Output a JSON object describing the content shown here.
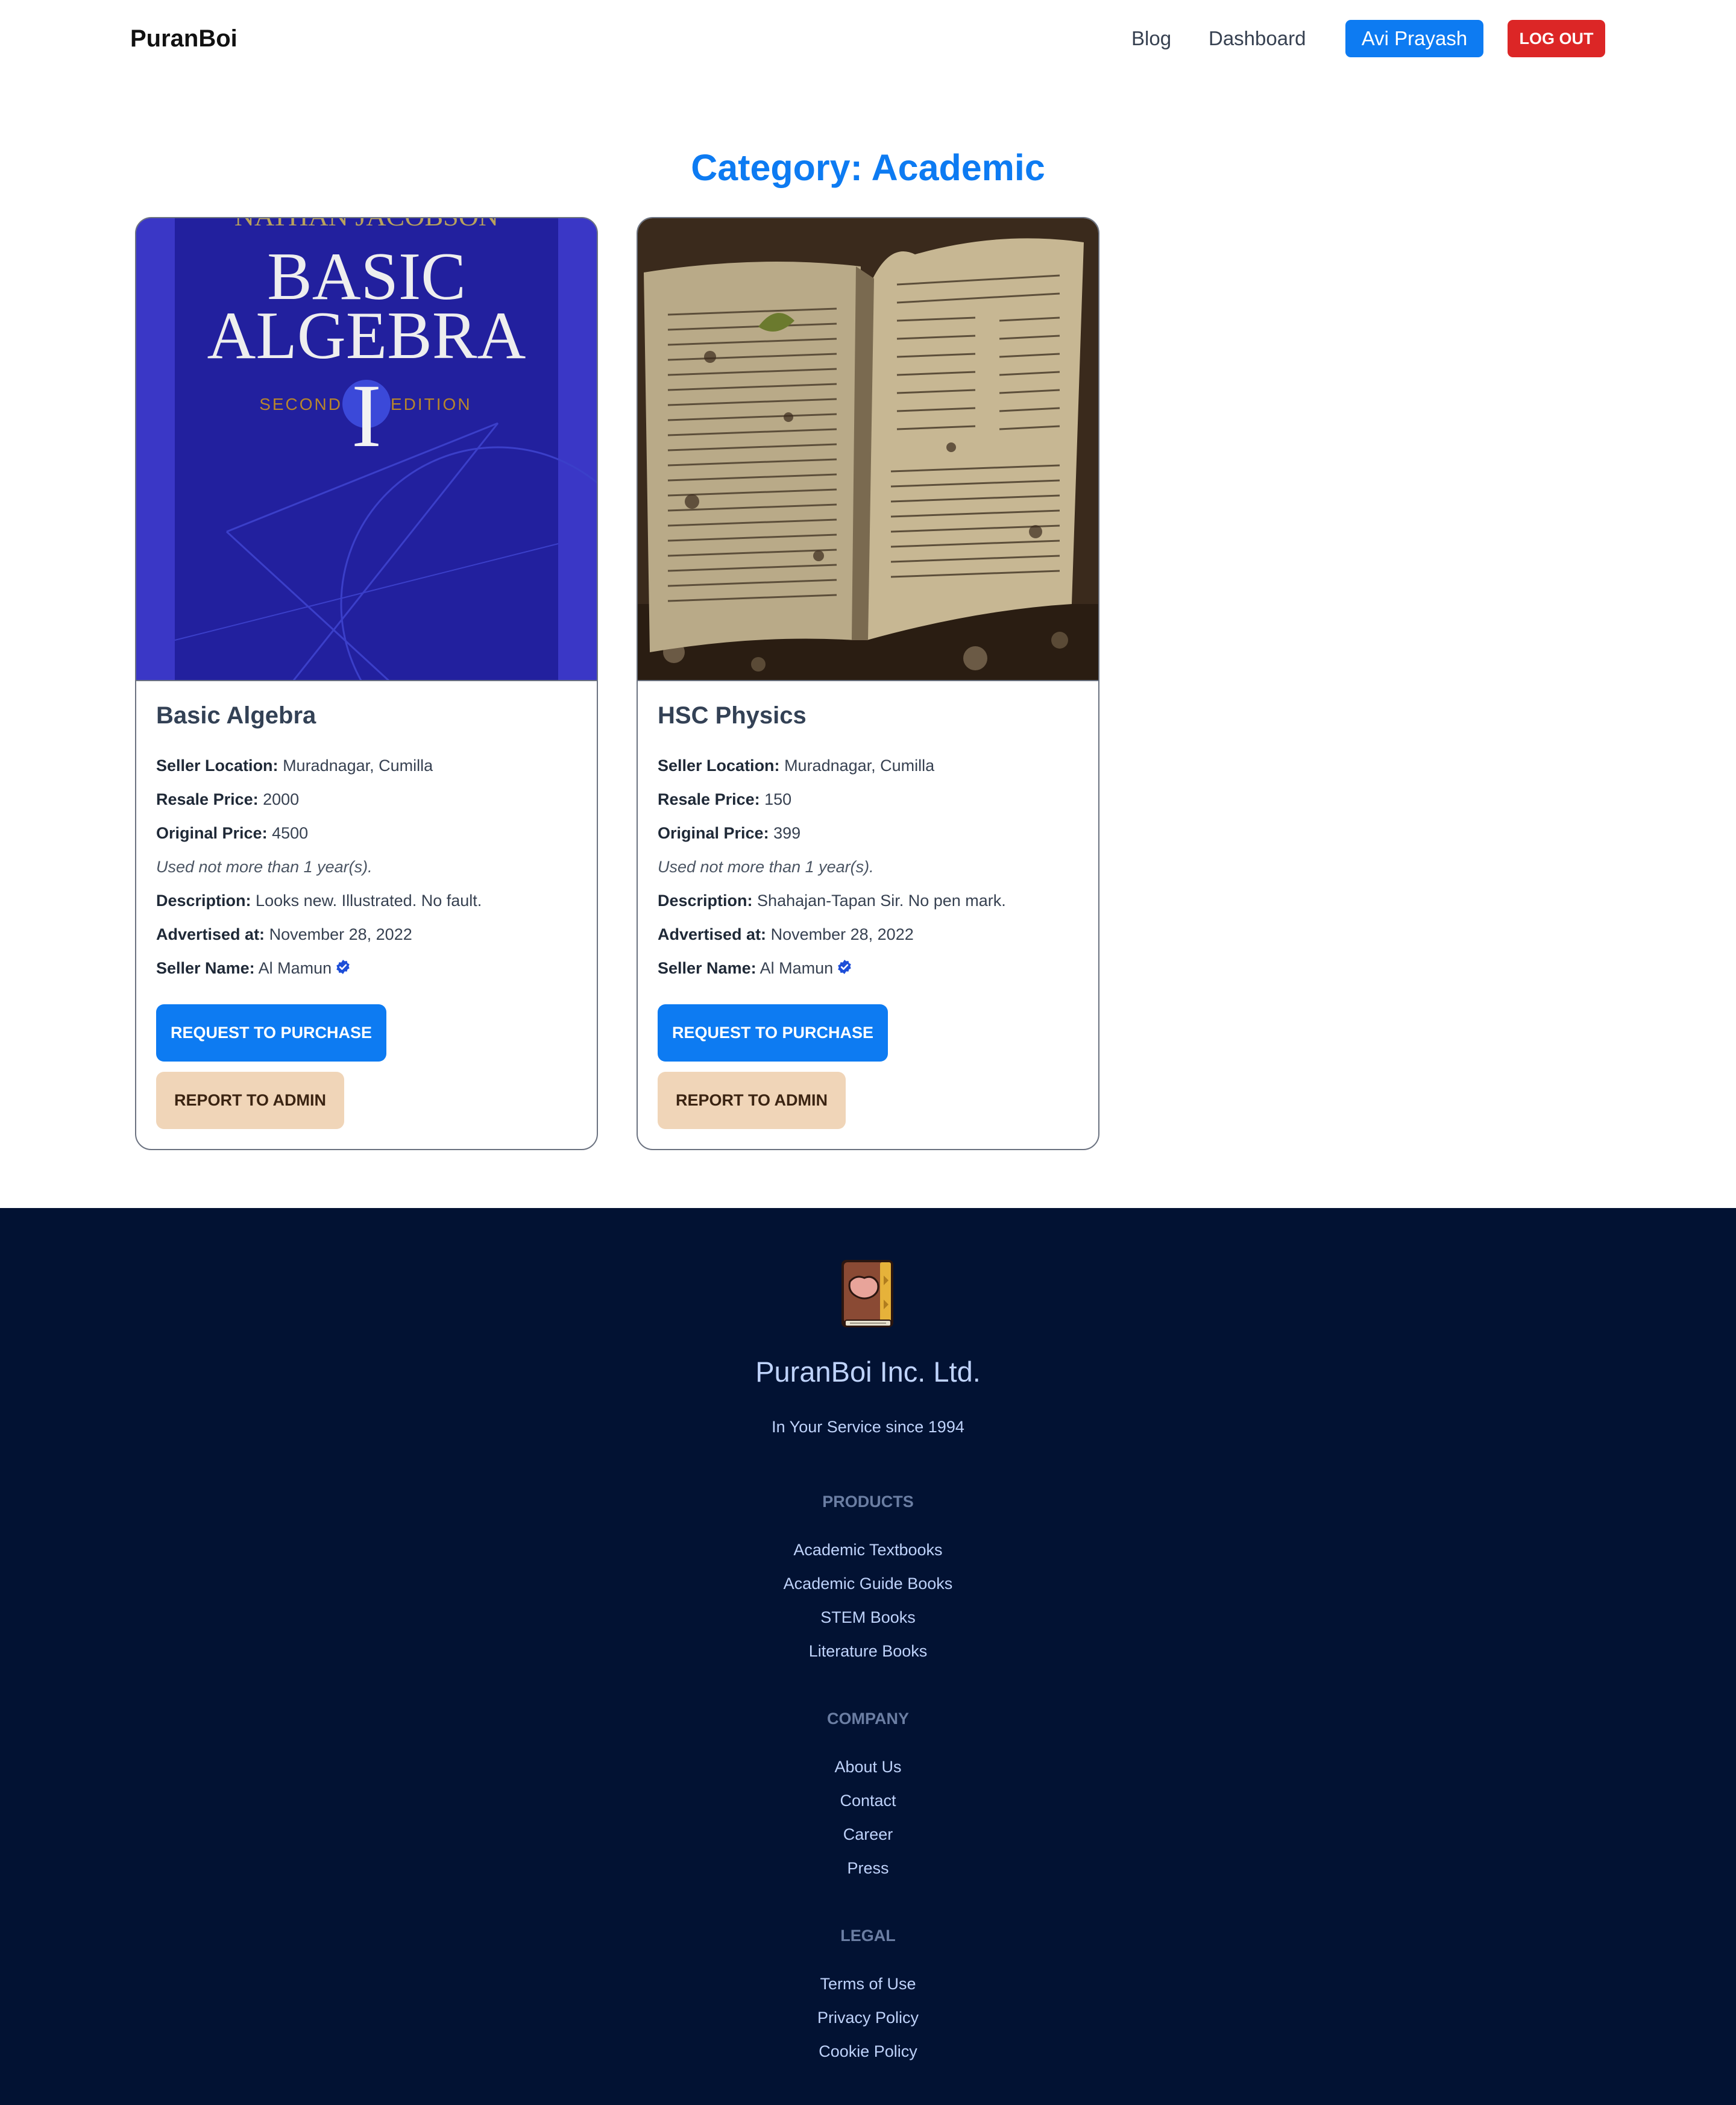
{
  "navbar": {
    "brand": "PuranBoi",
    "links": [
      "Blog",
      "Dashboard"
    ],
    "user_button": "Avi Prayash",
    "logout_button": "LOG OUT"
  },
  "heading": "Category: Academic",
  "labels": {
    "seller_location": "Seller Location:",
    "resale_price": "Resale Price:",
    "original_price": "Original Price:",
    "description": "Description:",
    "advertised_at": "Advertised at:",
    "seller_name": "Seller Name:"
  },
  "cards": [
    {
      "title": "Basic Algebra",
      "image": {
        "author": "NATHAN JACOBSON",
        "line1": "BASIC",
        "line2": "ALGEBRA",
        "edition_left": "SECOND",
        "edition_right": "EDITION",
        "numeral": "I"
      },
      "seller_location": "Muradnagar, Cumilla",
      "resale_price": "2000",
      "original_price": "4500",
      "usage": "Used not more than 1 year(s).",
      "description": "Looks new. Illustrated. No fault.",
      "advertised_at": "November 28, 2022",
      "seller_name": "Al Mamun",
      "purchase_button": "REQUEST TO PURCHASE",
      "report_button": "REPORT TO ADMIN"
    },
    {
      "title": "HSC Physics",
      "seller_location": "Muradnagar, Cumilla",
      "resale_price": "150",
      "original_price": "399",
      "usage": "Used not more than 1 year(s).",
      "description": "Shahajan-Tapan Sir. No pen mark.",
      "advertised_at": "November 28, 2022",
      "seller_name": "Al Mamun",
      "purchase_button": "REQUEST TO PURCHASE",
      "report_button": "REPORT TO ADMIN"
    }
  ],
  "footer": {
    "company_name": "PuranBoi Inc. Ltd.",
    "tagline": "In Your Service since 1994",
    "sections": [
      {
        "heading": "PRODUCTS",
        "links": [
          "Academic Textbooks",
          "Academic Guide Books",
          "STEM Books",
          "Literature Books"
        ]
      },
      {
        "heading": "COMPANY",
        "links": [
          "About Us",
          "Contact",
          "Career",
          "Press"
        ]
      },
      {
        "heading": "LEGAL",
        "links": [
          "Terms of Use",
          "Privacy Policy",
          "Cookie Policy"
        ]
      }
    ]
  },
  "colors": {
    "primary": "#0d7bf2",
    "danger": "#dc2626",
    "report": "#f0d5b8",
    "footer_bg": "#021233",
    "verified": "#1d4ed8"
  },
  "icons": {
    "verified": "verified-badge-icon",
    "footer_logo": "book-icon"
  }
}
